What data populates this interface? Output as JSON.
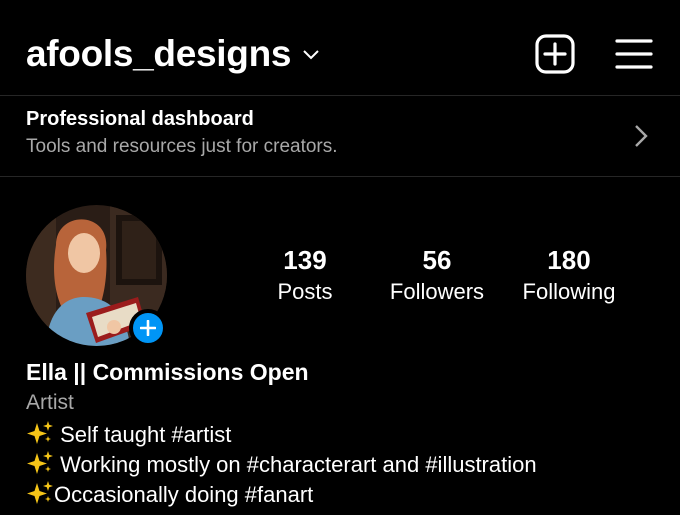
{
  "header": {
    "username": "afools_designs",
    "icons": {
      "switch": "chevron-down-icon",
      "create": "plus-square-icon",
      "menu": "hamburger-menu-icon"
    }
  },
  "dashboard": {
    "title": "Professional dashboard",
    "subtitle": "Tools and resources just for creators."
  },
  "profile": {
    "stats": [
      {
        "value": "139",
        "label": "Posts"
      },
      {
        "value": "56",
        "label": "Followers"
      },
      {
        "value": "180",
        "label": "Following"
      }
    ]
  },
  "bio": {
    "name": "Ella || Commissions Open",
    "category": "Artist",
    "lines": [
      " Self taught #artist",
      " Working mostly on #characterart and #illustration",
      "Occasionally doing  #fanart"
    ]
  },
  "colors": {
    "accent": "#0095f6",
    "muted": "#a8a8a8",
    "divider": "#262626",
    "sparkle": "#f5c518"
  }
}
